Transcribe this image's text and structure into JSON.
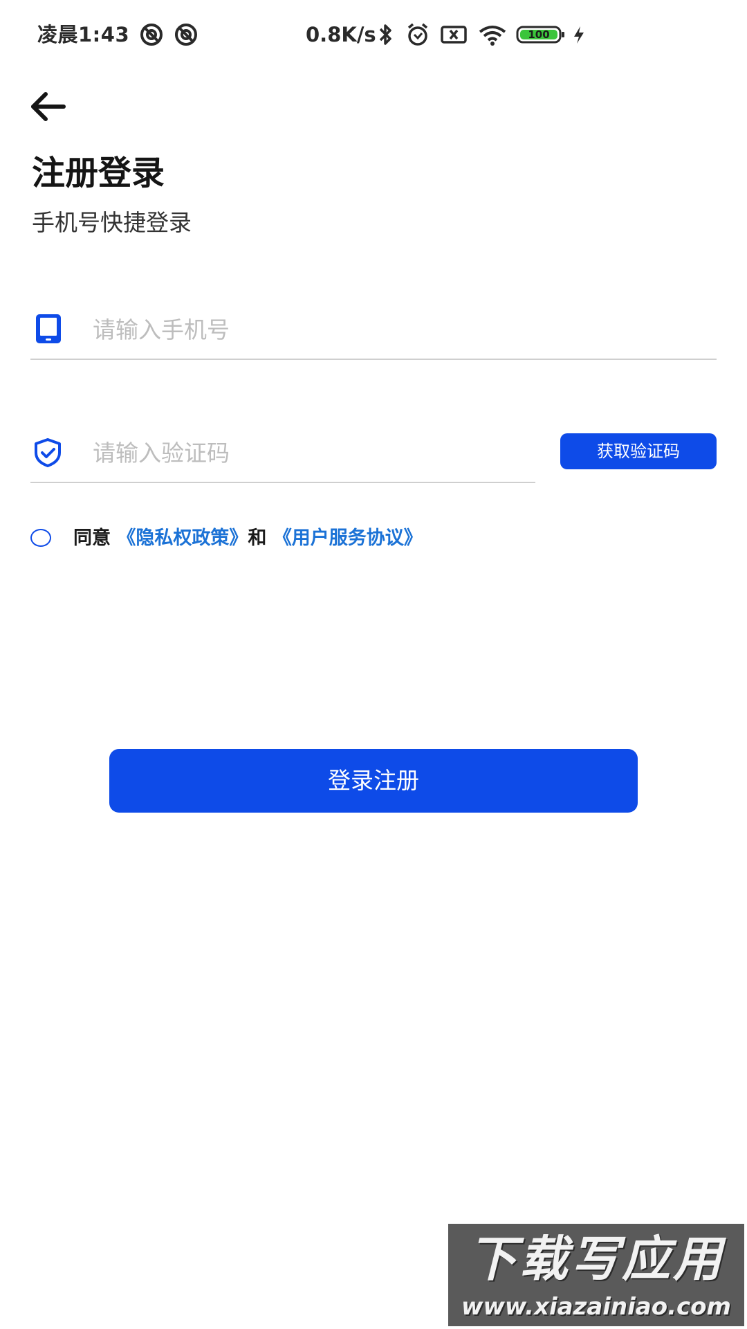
{
  "status_bar": {
    "time": "凌晨1:43",
    "network_speed": "0.8K/s",
    "battery": "100",
    "icons": [
      "hotspot-icon",
      "hotspot-icon",
      "bluetooth-icon",
      "alarm-icon",
      "sim-blocked-icon",
      "wifi-icon",
      "battery-icon",
      "charging-icon"
    ]
  },
  "header": {
    "back_icon": "arrow-left-icon",
    "title": "注册登录",
    "subtitle": "手机号快捷登录"
  },
  "form": {
    "phone": {
      "icon": "phone-icon",
      "placeholder": "请输入手机号",
      "value": ""
    },
    "code": {
      "icon": "shield-check-icon",
      "placeholder": "请输入验证码",
      "value": "",
      "get_code_label": "获取验证码"
    },
    "agreement": {
      "checked": false,
      "prefix": "同意",
      "privacy_link": "《隐私权政策》",
      "conjunction": "和",
      "terms_link": "《用户服务协议》"
    },
    "submit_label": "登录注册"
  },
  "watermark": {
    "title": "下载写应用",
    "url": "www.xiazainiao.com"
  },
  "colors": {
    "accent": "#0e4be8",
    "link": "#1b72d6",
    "placeholder": "#bdbdbd",
    "divider": "#cfcfcf"
  }
}
